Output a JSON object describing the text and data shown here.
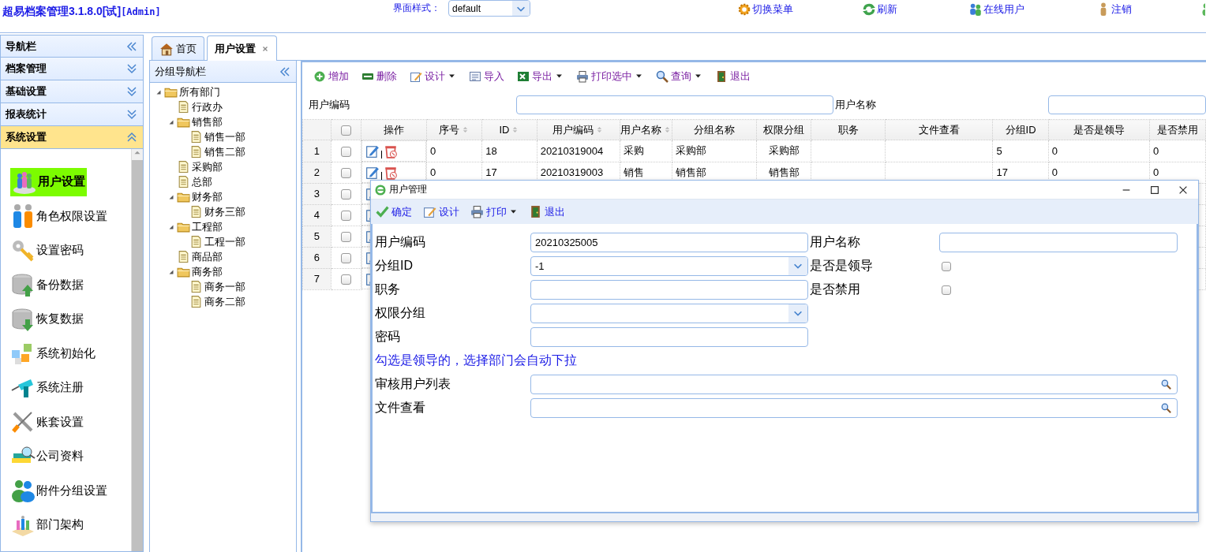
{
  "header": {
    "title": "超易档案管理3.1.8.0[试]",
    "title_suffix": "[Admin]",
    "theme_label": "界面样式：",
    "theme_value": "default",
    "links": [
      {
        "label": "切换菜单"
      },
      {
        "label": "刷新"
      },
      {
        "label": "在线用户"
      },
      {
        "label": "注销"
      }
    ]
  },
  "nav": {
    "title": "导航栏",
    "sections": [
      {
        "label": "档案管理",
        "expanded": false
      },
      {
        "label": "基础设置",
        "expanded": false
      },
      {
        "label": "报表统计",
        "expanded": false
      },
      {
        "label": "系统设置",
        "expanded": true
      }
    ],
    "items": [
      {
        "label": "用户设置",
        "selected": true
      },
      {
        "label": "角色权限设置",
        "selected": false
      },
      {
        "label": "设置密码",
        "selected": false
      },
      {
        "label": "备份数据",
        "selected": false
      },
      {
        "label": "恢复数据",
        "selected": false
      },
      {
        "label": "系统初始化",
        "selected": false
      },
      {
        "label": "系统注册",
        "selected": false
      },
      {
        "label": "账套设置",
        "selected": false
      },
      {
        "label": "公司资料",
        "selected": false
      },
      {
        "label": "附件分组设置",
        "selected": false
      },
      {
        "label": "部门架构",
        "selected": false
      }
    ]
  },
  "tabs": [
    {
      "label": "首页",
      "selected": false,
      "closable": false
    },
    {
      "label": "用户设置",
      "selected": true,
      "closable": true
    }
  ],
  "group_nav": {
    "title": "分组导航栏",
    "tree": [
      {
        "label": "所有部门",
        "kind": "folder",
        "expanded": true,
        "children": [
          {
            "label": "行政办",
            "kind": "leaf"
          },
          {
            "label": "销售部",
            "kind": "folder",
            "expanded": true,
            "children": [
              {
                "label": "销售一部",
                "kind": "leaf"
              },
              {
                "label": "销售二部",
                "kind": "leaf"
              }
            ]
          },
          {
            "label": "采购部",
            "kind": "leaf"
          },
          {
            "label": "总部",
            "kind": "leaf"
          },
          {
            "label": "财务部",
            "kind": "folder",
            "expanded": true,
            "children": [
              {
                "label": "财务三部",
                "kind": "leaf"
              }
            ]
          },
          {
            "label": "工程部",
            "kind": "folder",
            "expanded": true,
            "children": [
              {
                "label": "工程一部",
                "kind": "leaf"
              }
            ]
          },
          {
            "label": "商品部",
            "kind": "leaf"
          },
          {
            "label": "商务部",
            "kind": "folder",
            "expanded": true,
            "children": [
              {
                "label": "商务一部",
                "kind": "leaf"
              },
              {
                "label": "商务二部",
                "kind": "leaf"
              }
            ]
          }
        ]
      }
    ]
  },
  "toolbar": [
    {
      "label": "增加",
      "dropdown": false
    },
    {
      "label": "删除",
      "dropdown": false
    },
    {
      "label": "设计",
      "dropdown": true
    },
    {
      "label": "导入",
      "dropdown": false
    },
    {
      "label": "导出",
      "dropdown": true
    },
    {
      "label": "打印选中",
      "dropdown": true
    },
    {
      "label": "查询",
      "dropdown": true
    },
    {
      "label": "退出",
      "dropdown": false
    }
  ],
  "search": [
    {
      "label": "用户编码"
    },
    {
      "label": "用户名称"
    }
  ],
  "table": {
    "header_checked": false,
    "columns": [
      {
        "label": "操作",
        "sortable": false
      },
      {
        "label": "序号",
        "sortable": true
      },
      {
        "label": "ID",
        "sortable": true
      },
      {
        "label": "用户编码",
        "sortable": true
      },
      {
        "label": "用户名称",
        "sortable": true
      },
      {
        "label": "分组名称",
        "sortable": false
      },
      {
        "label": "权限分组",
        "sortable": false
      },
      {
        "label": "职务",
        "sortable": false
      },
      {
        "label": "文件查看",
        "sortable": false
      },
      {
        "label": "分组ID",
        "sortable": false
      },
      {
        "label": "是否是领导",
        "sortable": false
      },
      {
        "label": "是否禁用",
        "sortable": false
      }
    ],
    "rows": [
      {
        "num": "1",
        "checked": false,
        "seq": "0",
        "id": "18",
        "code": "20210319004",
        "name": "采购",
        "group": "采购部",
        "perm_group": "采购部",
        "group_id": "5",
        "leader": "0",
        "disabled": "0"
      },
      {
        "num": "2",
        "checked": false,
        "seq": "0",
        "id": "17",
        "code": "20210319003",
        "name": "销售",
        "group": "销售部",
        "perm_group": "销售部",
        "group_id": "17",
        "leader": "0",
        "disabled": "0"
      },
      {
        "num": "3",
        "checked": false
      },
      {
        "num": "4",
        "checked": false
      },
      {
        "num": "5",
        "checked": false
      },
      {
        "num": "6",
        "checked": false
      },
      {
        "num": "7",
        "checked": false
      }
    ]
  },
  "dialog": {
    "title": "用户管理",
    "toolbar": [
      {
        "label": "确定",
        "dropdown": false
      },
      {
        "label": "设计",
        "dropdown": false
      },
      {
        "label": "打印",
        "dropdown": true
      },
      {
        "label": "退出",
        "dropdown": false
      }
    ],
    "rows": [
      [
        {
          "label": "用户编码",
          "kind": "text",
          "value": "20210325005"
        },
        {
          "label": "用户名称",
          "kind": "text"
        }
      ],
      [
        {
          "label": "分组ID",
          "kind": "combo",
          "value": "-1"
        },
        {
          "label": "是否是领导",
          "kind": "checkbox",
          "checked": false
        }
      ],
      [
        {
          "label": "职务",
          "kind": "text"
        },
        {
          "label": "是否禁用",
          "kind": "checkbox",
          "checked": false
        }
      ],
      [
        {
          "label": "权限分组",
          "kind": "combo"
        }
      ],
      [
        {
          "label": "密码",
          "kind": "text"
        }
      ],
      [
        {
          "kind": "note",
          "text": "勾选是领导的，选择部门会自动下拉"
        }
      ],
      [
        {
          "label": "审核用户列表",
          "kind": "search"
        }
      ],
      [
        {
          "label": "文件查看",
          "kind": "search"
        }
      ]
    ]
  }
}
